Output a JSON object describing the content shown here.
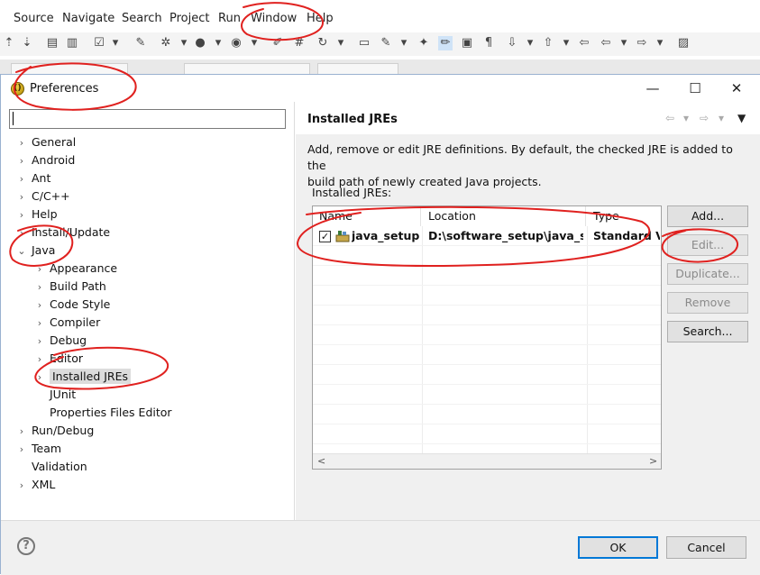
{
  "menubar": {
    "items": [
      "Source",
      "Navigate",
      "Search",
      "Project",
      "Run",
      "Window",
      "Help"
    ]
  },
  "dialog": {
    "title": "Preferences",
    "icon": "eclipse-preferences-icon",
    "window_controls": {
      "minimize": "—",
      "maximize": "☐",
      "close": "✕"
    }
  },
  "filter": {
    "value": ""
  },
  "tree": [
    {
      "label": "General",
      "depth": 0,
      "expander": "collapsed"
    },
    {
      "label": "Android",
      "depth": 0,
      "expander": "collapsed"
    },
    {
      "label": "Ant",
      "depth": 0,
      "expander": "collapsed"
    },
    {
      "label": "C/C++",
      "depth": 0,
      "expander": "collapsed"
    },
    {
      "label": "Help",
      "depth": 0,
      "expander": "collapsed"
    },
    {
      "label": "Install/Update",
      "depth": 0,
      "expander": "collapsed"
    },
    {
      "label": "Java",
      "depth": 0,
      "expander": "expanded"
    },
    {
      "label": "Appearance",
      "depth": 1,
      "expander": "collapsed"
    },
    {
      "label": "Build Path",
      "depth": 1,
      "expander": "collapsed"
    },
    {
      "label": "Code Style",
      "depth": 1,
      "expander": "collapsed"
    },
    {
      "label": "Compiler",
      "depth": 1,
      "expander": "collapsed"
    },
    {
      "label": "Debug",
      "depth": 1,
      "expander": "collapsed"
    },
    {
      "label": "Editor",
      "depth": 1,
      "expander": "collapsed"
    },
    {
      "label": "Installed JREs",
      "depth": 1,
      "expander": "collapsed",
      "selected": true
    },
    {
      "label": "JUnit",
      "depth": 1,
      "expander": "none"
    },
    {
      "label": "Properties Files Editor",
      "depth": 1,
      "expander": "none"
    },
    {
      "label": "Run/Debug",
      "depth": 0,
      "expander": "collapsed"
    },
    {
      "label": "Team",
      "depth": 0,
      "expander": "collapsed"
    },
    {
      "label": "Validation",
      "depth": 0,
      "expander": "none"
    },
    {
      "label": "XML",
      "depth": 0,
      "expander": "collapsed"
    }
  ],
  "page": {
    "title": "Installed JREs",
    "description_line1": "Add, remove or edit JRE definitions. By default, the checked JRE is added to the",
    "description_line2": "build path of newly created Java projects.",
    "list_label": "Installed JREs:",
    "nav": {
      "back": "⇦",
      "forward": "⇨",
      "menu": "▾",
      "view_menu": "▼"
    }
  },
  "table": {
    "columns": [
      "Name",
      "Location",
      "Type"
    ],
    "rows": [
      {
        "checked": true,
        "name": "java_setup...",
        "location": "D:\\software_setup\\java_se",
        "type": "Standard V"
      }
    ],
    "scroll_left": "<",
    "scroll_right": ">"
  },
  "buttons": {
    "add": "Add...",
    "edit": "Edit...",
    "duplicate": "Duplicate...",
    "remove": "Remove",
    "search": "Search..."
  },
  "footer": {
    "help": "?",
    "ok": "OK",
    "cancel": "Cancel"
  },
  "colors": {
    "annotation": "#e0211f",
    "selection": "#dcdcdc",
    "default_button_border": "#0078d7"
  }
}
